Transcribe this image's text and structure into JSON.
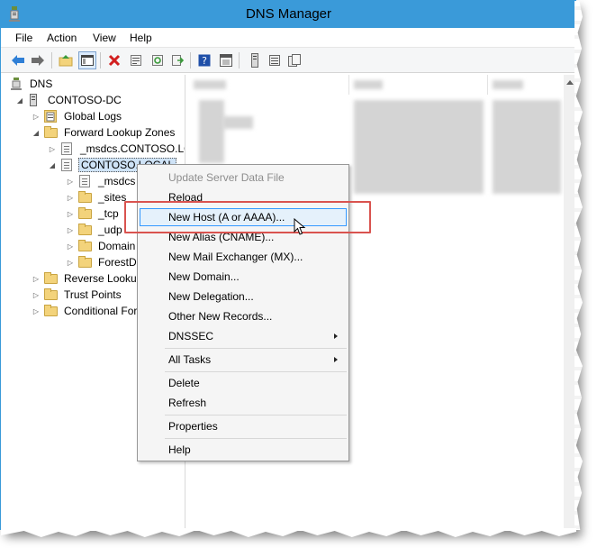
{
  "window": {
    "title": "DNS Manager"
  },
  "menubar": {
    "items": [
      "File",
      "Action",
      "View",
      "Help"
    ]
  },
  "toolbar": {
    "icons": [
      "back-arrow-icon",
      "forward-arrow-icon",
      "up-folder-icon",
      "show-hide-tree-icon",
      "delete-icon",
      "properties-icon",
      "refresh-icon",
      "export-icon",
      "help-icon",
      "console-icon",
      "server-icon",
      "list-icon",
      "records-icon"
    ]
  },
  "tree": {
    "root": "DNS",
    "server": "CONTOSO-DC",
    "global_logs": "Global Logs",
    "forward_zones": "Forward Lookup Zones",
    "msdcs_zone": "_msdcs.CONTOSO.LO",
    "contoso_zone": "CONTOSO.LOCAL",
    "msdcs": "_msdcs",
    "sites": "_sites",
    "tcp": "_tcp",
    "udp": "_udp",
    "domain_dns": "Domain",
    "forest_dns": "ForestDn",
    "reverse_zones": "Reverse Lookup",
    "trust_points": "Trust Points",
    "conditional": "Conditional For"
  },
  "context_menu": {
    "update_server": "Update Server Data File",
    "reload": "Reload",
    "new_host": "New Host (A or AAAA)...",
    "new_alias": "New Alias (CNAME)...",
    "new_mx": "New Mail Exchanger (MX)...",
    "new_domain": "New Domain...",
    "new_delegation": "New Delegation...",
    "other_records": "Other New Records...",
    "dnssec": "DNSSEC",
    "all_tasks": "All Tasks",
    "delete": "Delete",
    "refresh": "Refresh",
    "properties": "Properties",
    "help": "Help"
  },
  "colors": {
    "titlebar": "#3a9ad9",
    "highlight_box": "#d9534f",
    "menu_hover": "#e5f1fb",
    "menu_hover_border": "#3399ff"
  }
}
